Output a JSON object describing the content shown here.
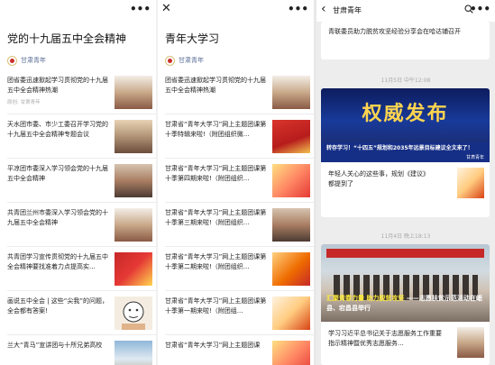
{
  "panel1": {
    "title": "党的十九届五中全会精神",
    "account": "甘肃青年",
    "items": [
      {
        "title": "团省委迅速掀起学习贯彻党的十九届五中全会精神热潮",
        "source": "原创: 甘肃青年"
      },
      {
        "title": "天水团市委、市少工委召开学习党的十九届五中全会精神专题会议",
        "source": ""
      },
      {
        "title": "平凉团市委深入学习领会党的十九届五中全会精神",
        "source": ""
      },
      {
        "title": "共青团兰州市委深入学习领会党的十九届五中全会精神",
        "source": ""
      },
      {
        "title": "共青团学习宣传贯彻党的十九届五中全会精神要找准着力点提高实...",
        "source": ""
      },
      {
        "title": "画说五中全会 | 这些“尖我”的问题，全会都有答案!",
        "source": ""
      },
      {
        "title": "兰大“青马”宣讲团与十所兄弟高校",
        "source": ""
      }
    ]
  },
  "panel2": {
    "title": "青年大学习",
    "account": "甘肃青年",
    "items": [
      {
        "title": "团省委迅速掀起学习贯彻党的十九届五中全会精神热潮"
      },
      {
        "title": "甘肃省“青年大学习”网上主题团课第十季特辑来啦!（附团组织微..."
      },
      {
        "title": "甘肃省“青年大学习”网上主题团课第十季第四期来啦!（附团组织..."
      },
      {
        "title": "甘肃省“青年大学习”网上主题团课第十季第三期来啦!（附团组织..."
      },
      {
        "title": "甘肃省“青年大学习”网上主题团课第十季第二期来啦!（附团组织..."
      },
      {
        "title": "甘肃省“青年大学习”网上主题团课第十季第一期来啦!（附团组..."
      },
      {
        "title": "甘肃省“青年大学习”网上主题团课"
      }
    ]
  },
  "panel3": {
    "title": "甘肃青年",
    "top_card_text": "青联委员助力脱贫攻坚经验分享会在哈达铺召开",
    "stamp1": "11月5日 中午12:08",
    "banner_title": "权威发布",
    "banner_caption": "转存学习！“十四五”规划和2035年远景目标建议全文来了！",
    "banner_source": "甘肃青年",
    "sub_text": "年轻人关心的这些事，规划《建议》都提到了",
    "stamp2": "11月4日 晚上18:13",
    "photo_caption_title": "汇聚青春力量 助力脱贫攻坚",
    "photo_caption_rest": "——志愿扶贫示范活动在岷县、宕昌县举行",
    "bottom_text": "学习习近平总书记关于志愿服务工作重要指示精神暨优秀志愿服务..."
  }
}
